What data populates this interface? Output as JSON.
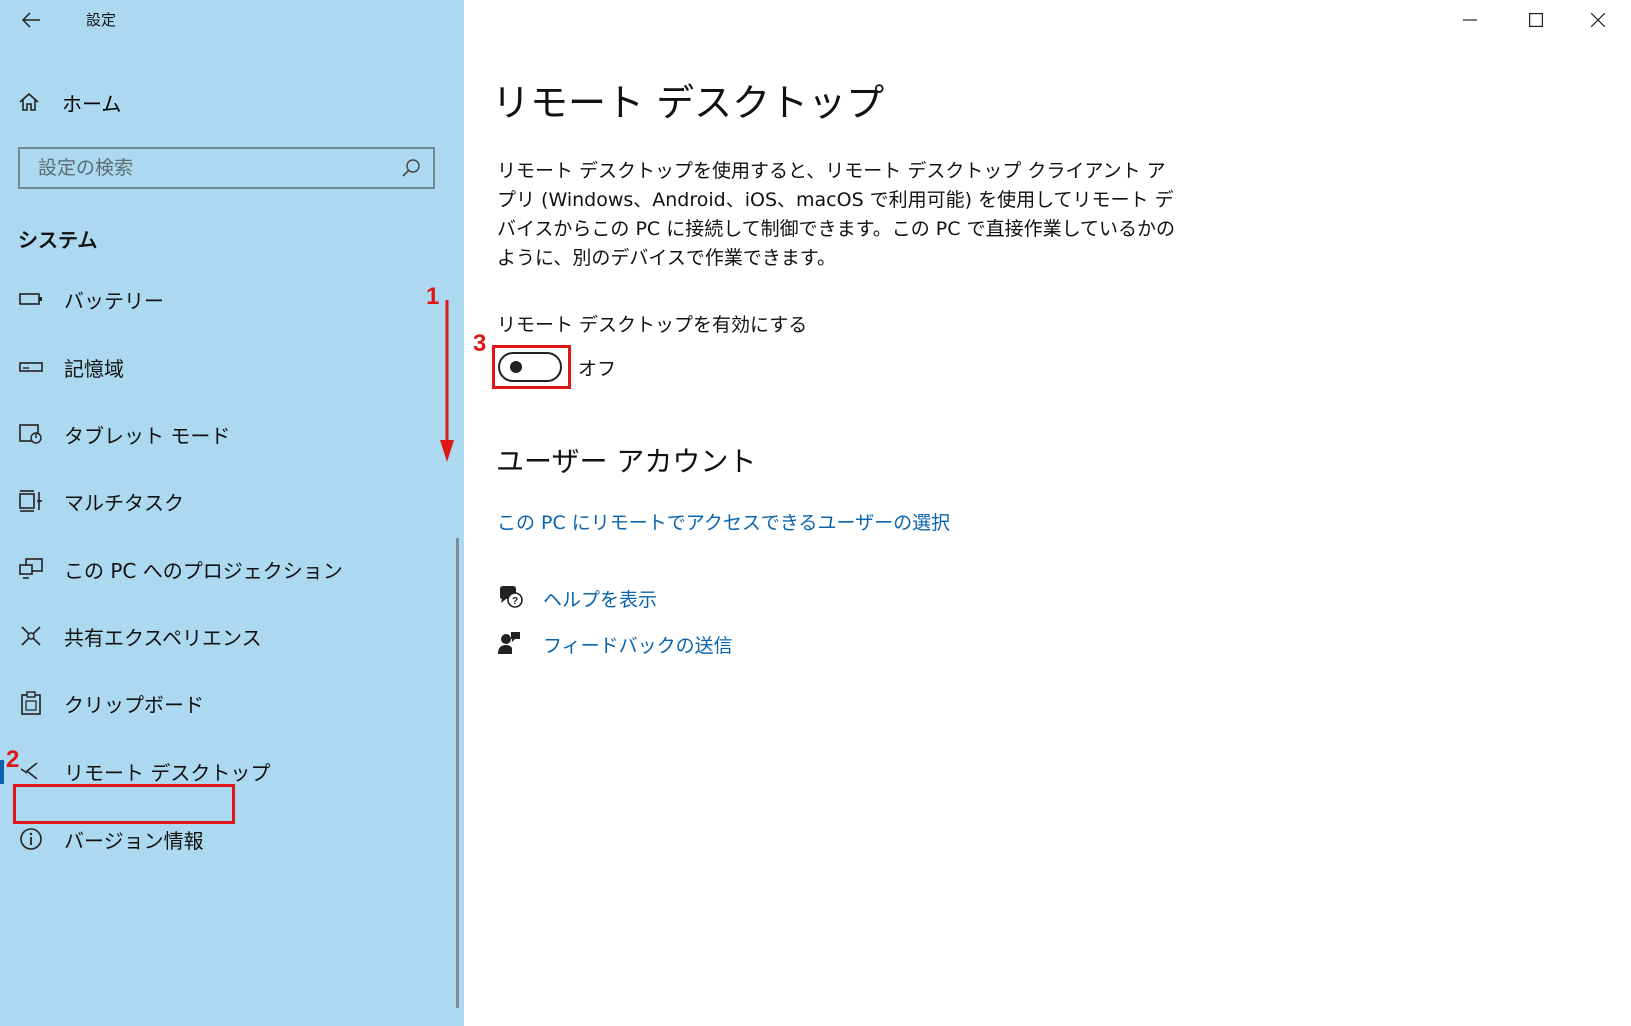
{
  "window": {
    "title": "設定",
    "controls": [
      "minimize",
      "maximize",
      "close"
    ]
  },
  "sidebar": {
    "back_icon": "back-arrow-icon",
    "home_label": "ホーム",
    "search_placeholder": "設定の検索",
    "section_title": "システム",
    "items": [
      {
        "label": "バッテリー",
        "icon": "battery-icon"
      },
      {
        "label": "記憶域",
        "icon": "storage-icon"
      },
      {
        "label": "タブレット モード",
        "icon": "tablet-mode-icon"
      },
      {
        "label": "マルチタスク",
        "icon": "multitasking-icon"
      },
      {
        "label": "この PC へのプロジェクション",
        "icon": "projection-icon"
      },
      {
        "label": "共有エクスペリエンス",
        "icon": "shared-experiences-icon"
      },
      {
        "label": "クリップボード",
        "icon": "clipboard-icon"
      },
      {
        "label": "リモート デスクトップ",
        "icon": "remote-desktop-icon",
        "selected": true
      },
      {
        "label": "バージョン情報",
        "icon": "info-icon"
      }
    ]
  },
  "main": {
    "title": "リモート デスクトップ",
    "description": "リモート デスクトップを使用すると、リモート デスクトップ クライアント アプリ (Windows、Android、iOS、macOS で利用可能) を使用してリモート デバイスからこの PC に接続して制御できます。この PC で直接作業しているかのように、別のデバイスで作業できます。",
    "toggle_label": "リモート デスクトップを有効にする",
    "toggle_state": "オフ",
    "toggle_on": false,
    "user_accounts_heading": "ユーザー アカウント",
    "select_users_link": "この PC にリモートでアクセスできるユーザーの選択",
    "help_link": "ヘルプを表示",
    "feedback_link": "フィードバックの送信"
  },
  "annotations": {
    "step1": "1",
    "step2": "2",
    "step3": "3",
    "color": "#e11717"
  },
  "colors": {
    "sidebar_bg": "#acd9ef",
    "accent": "#0a64ad"
  }
}
